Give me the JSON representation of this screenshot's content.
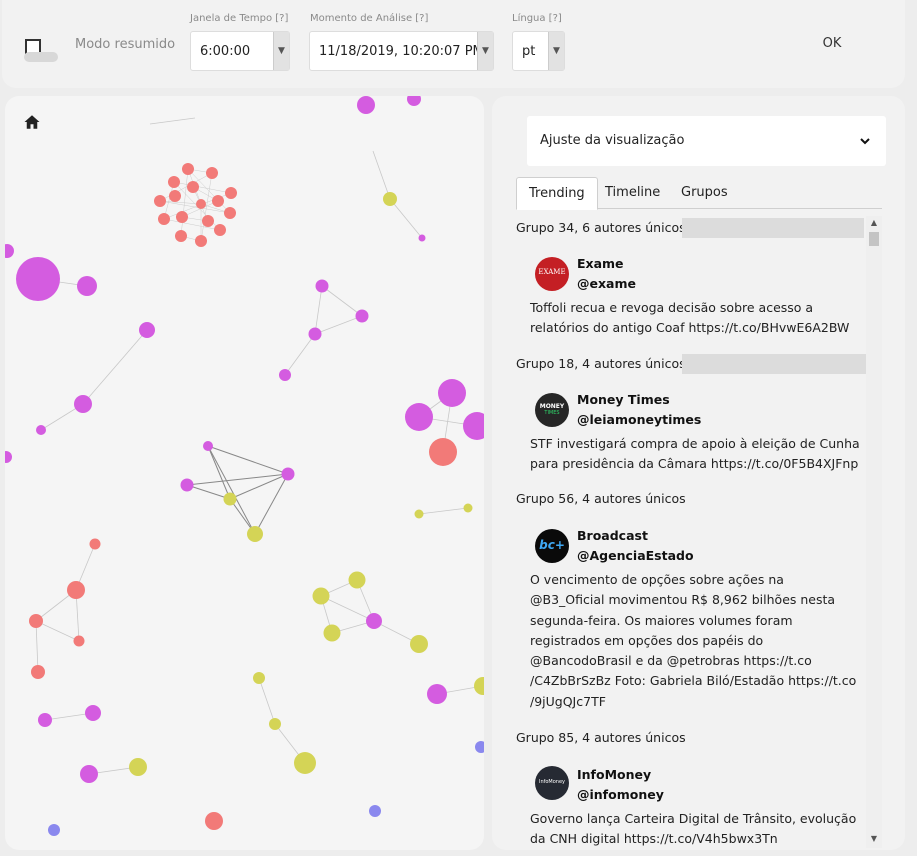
{
  "header": {
    "modo_resumido_label": "Modo resumido",
    "janela": {
      "label": "Janela de Tempo [?]",
      "value": "6:00:00"
    },
    "momento": {
      "label": "Momento de Análise [?]",
      "value": "11/18/2019, 10:20:07 PM"
    },
    "lingua": {
      "label": "Língua [?]",
      "value": "pt"
    },
    "ok_label": "OK"
  },
  "graph": {
    "home_icon": "home-icon",
    "node_colors": {
      "magenta": "#d45ce0",
      "salmon": "#f27a78",
      "olive": "#d4d456",
      "blue": "#8a88ee"
    }
  },
  "panel": {
    "ajuste_label": "Ajuste da visualização",
    "tabs": [
      "Trending",
      "Timeline",
      "Grupos"
    ],
    "active_tab": "Trending",
    "groups": [
      {
        "header": "Grupo 34, 6 autores únicos",
        "name": "Exame",
        "handle": "@exame",
        "avatar_text": "EXAME",
        "text": "Toffoli recua e revoga decisão sobre acesso a relatórios do antigo Coaf https://t.co/BHvwE6A2BW"
      },
      {
        "header": "Grupo 18, 4 autores únicos",
        "name": "Money Times",
        "handle": "@leiamoneytimes",
        "avatar_text": "MONEY",
        "avatar_text2": "TIMES",
        "text": "STF investigará compra de apoio à eleição de Cunha para presidência da Câmara https://t.co/0F5B4XJFnp"
      },
      {
        "header": "Grupo 56, 4 autores únicos",
        "name": "Broadcast",
        "handle": "@AgenciaEstado",
        "avatar_text": "bc+",
        "text": "O vencimento de opções sobre ações na @B3_Oficial movimentou R$ 8,962 bilhões nesta segunda-feira. Os maiores volumes foram registrados em opções dos papéis do @BancodoBrasil e da @petrobras https://t.co /C4ZbBrSzBz Foto: Gabriela Biló/Estadão https://t.co /9jUgQJc7TF"
      },
      {
        "header": "Grupo 85, 4 autores únicos",
        "name": "InfoMoney",
        "handle": "@infomoney",
        "avatar_text": "InfoMoney",
        "text": "Governo lança Carteira Digital de Trânsito, evolução da CNH digital https://t.co/V4h5bwx3Tn"
      }
    ]
  }
}
